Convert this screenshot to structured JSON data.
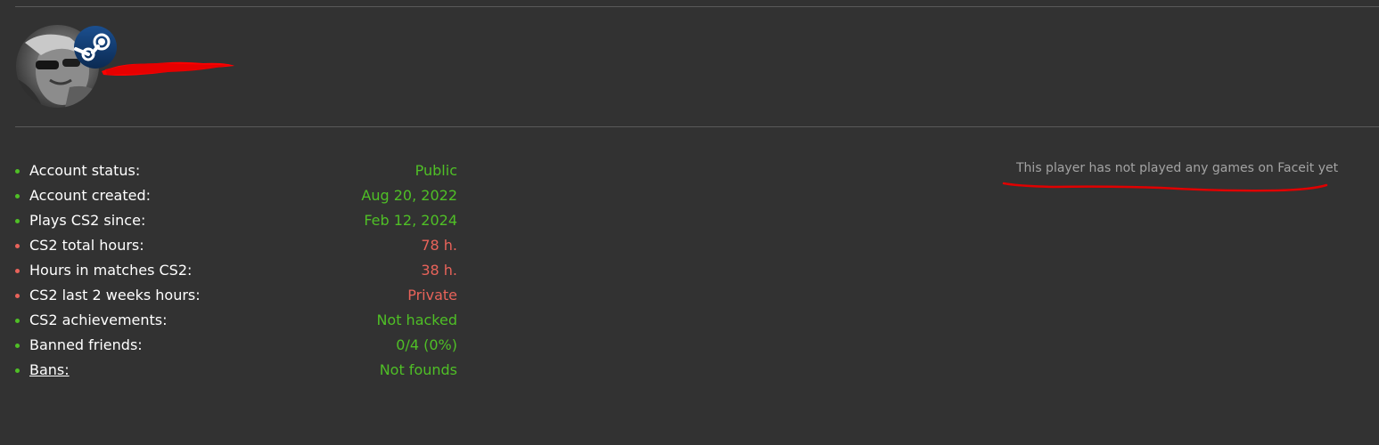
{
  "profile": {
    "avatar_alt": "avatar",
    "badge_icon": "steam-icon",
    "redaction_color": "#ff0000"
  },
  "stats": [
    {
      "label": "Account status:",
      "value": "Public",
      "status": "green"
    },
    {
      "label": "Account created:",
      "value": "Aug 20, 2022",
      "status": "green"
    },
    {
      "label": "Plays CS2 since:",
      "value": "Feb 12, 2024",
      "status": "green"
    },
    {
      "label": "CS2 total hours:",
      "value": "78 h.",
      "status": "red"
    },
    {
      "label": "Hours in matches CS2:",
      "value": "38 h.",
      "status": "red"
    },
    {
      "label": "CS2 last 2 weeks hours:",
      "value": "Private",
      "status": "red"
    },
    {
      "label": "CS2 achievements:",
      "value": "Not hacked",
      "status": "green"
    },
    {
      "label": "Banned friends:",
      "value": "0/4 (0%)",
      "status": "green"
    },
    {
      "label": "Bans:",
      "value": "Not founds",
      "status": "green"
    }
  ],
  "faceit": {
    "message": "This player has not played any games on Faceit yet"
  },
  "colors": {
    "background": "#323232",
    "good": "#4fbf26",
    "bad": "#e8635a",
    "muted": "#a3a3a3",
    "annotation": "#e00000"
  }
}
